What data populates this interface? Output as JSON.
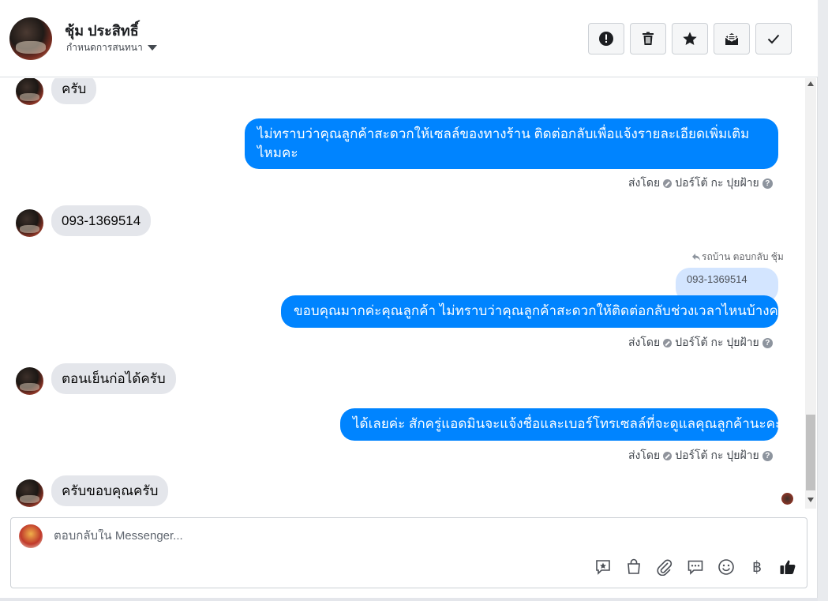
{
  "header": {
    "name": "ชุ้ม ประสิทธิ์",
    "subtitle": "กำหนดการสนทนา",
    "actions": [
      {
        "icon": "alert-icon",
        "label": "Report"
      },
      {
        "icon": "trash-icon",
        "label": "Delete"
      },
      {
        "icon": "star-icon",
        "label": "Star"
      },
      {
        "icon": "mark-unread-icon",
        "label": "Mark unread"
      },
      {
        "icon": "check-icon",
        "label": "Done"
      }
    ]
  },
  "messages": {
    "m1": {
      "text": "ครับ"
    },
    "m2": {
      "text": "ไม่ทราบว่าคุณลูกค้าสะดวกให้เซลล์ของทางร้าน ติดต่อกลับเพื่อแจ้งรายละเอียดเพิ่มเติมไหมคะ",
      "sent_by": "ส่งโดย",
      "sender": "ปอร์โต้ กะ ปุยฝ้าย"
    },
    "m3": {
      "text": "093-1369514"
    },
    "m4": {
      "reply_note": "รถบ้าน ตอบกลับ ชุ้ม",
      "quoted": "093-1369514",
      "text": "ขอบคุณมากค่ะคุณลูกค้า ไม่ทราบว่าคุณลูกค้าสะดวกให้ติดต่อกลับช่วงเวลาไหนบ้างคะ",
      "sent_by": "ส่งโดย",
      "sender": "ปอร์โต้ กะ ปุยฝ้าย"
    },
    "m5": {
      "text": "ตอนเย็นก่อได้ครับ"
    },
    "m6": {
      "text": "ได้เลยค่ะ สักครู่แอดมินจะแจ้งชื่อและเบอร์โทรเซลล์ที่จะดูแลคุณลูกค้านะคะ",
      "sent_by": "ส่งโดย",
      "sender": "ปอร์โต้ กะ ปุยฝ้าย"
    },
    "m7": {
      "text": "ครับขอบคุณครับ"
    }
  },
  "composer": {
    "placeholder": "ตอบกลับใน Messenger...",
    "value": "",
    "tools": [
      "saved-reply-icon",
      "shop-icon",
      "attach-icon",
      "chat-icon",
      "emoji-icon",
      "baht-icon",
      "like-icon"
    ],
    "baht_symbol": "฿"
  },
  "colors": {
    "outgoing_bubble": "#0084ff",
    "incoming_bubble": "#e4e6eb",
    "quote_bubble": "#d3e5ff"
  }
}
